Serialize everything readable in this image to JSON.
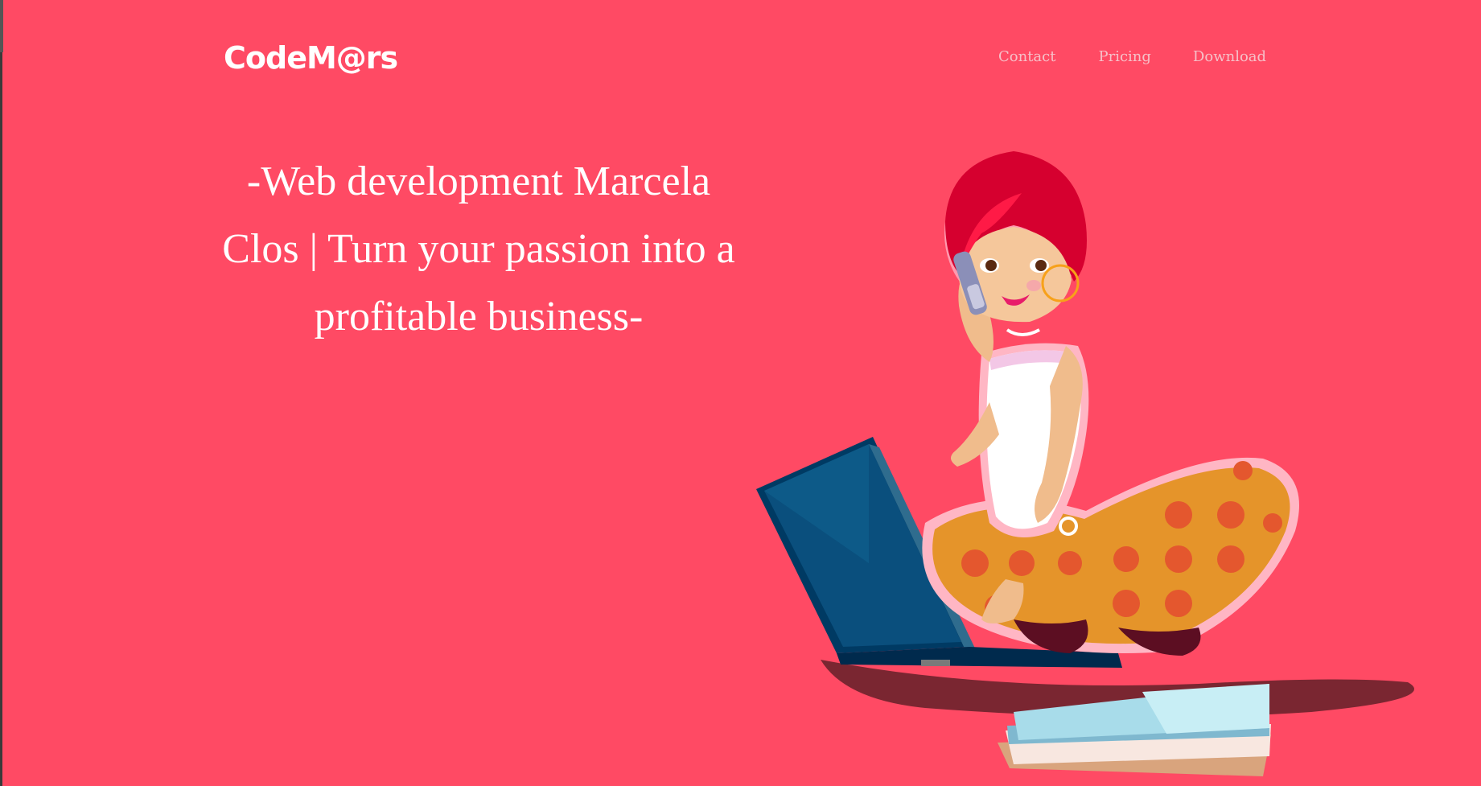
{
  "header": {
    "logo": "CodeM@rs",
    "nav": [
      {
        "label": "Contact"
      },
      {
        "label": "Pricing"
      },
      {
        "label": "Download"
      }
    ]
  },
  "hero": {
    "headline": "-Web development Marcela Clos | Turn your passion into a profitable business-"
  },
  "colors": {
    "background": "#ff4a64",
    "text": "#ffffff",
    "nav_text": "#f6c0c8"
  },
  "illustration": {
    "subject": "woman-on-phone-with-laptop-illustration"
  }
}
